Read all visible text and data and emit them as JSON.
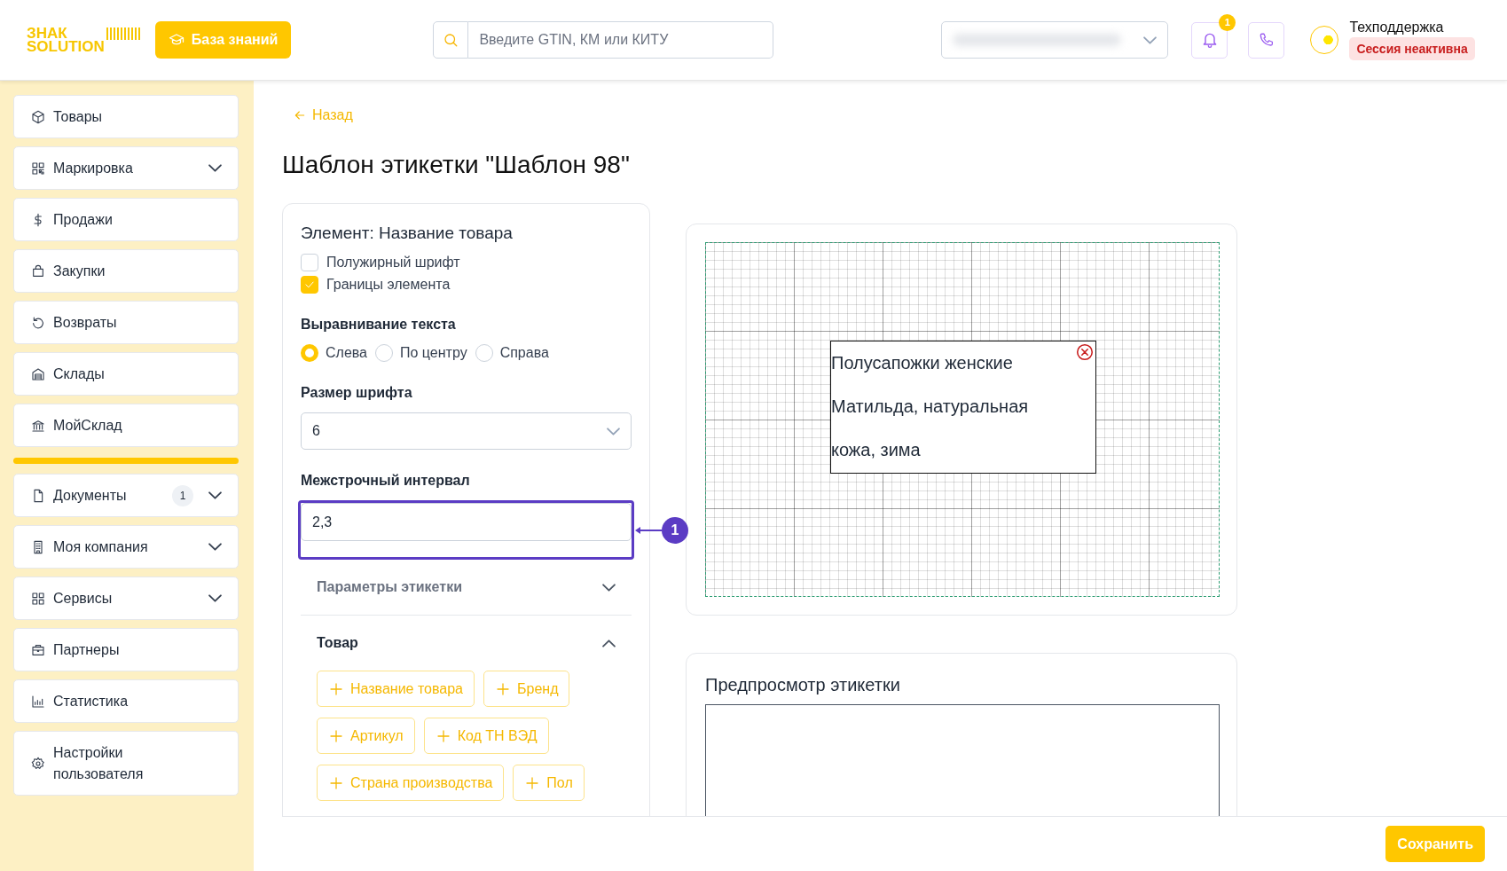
{
  "header": {
    "logo": {
      "line_1": "ЗНАК",
      "line_2": "SOLUTION"
    },
    "knowledge_button": "База знаний",
    "search": {
      "placeholder": "Введите GTIN, КМ или КИТУ"
    },
    "notifications": {
      "badge": "1"
    },
    "user": {
      "name": "Техподдержка",
      "status": "Сессия неактивна"
    }
  },
  "sidebar": {
    "groups": [
      {
        "items": [
          {
            "label": "Товары",
            "kind": "box",
            "expandable": false
          },
          {
            "label": "Маркировка",
            "kind": "qr",
            "expandable": true
          },
          {
            "label": "Продажи",
            "kind": "dollar",
            "expandable": false
          },
          {
            "label": "Закупки",
            "kind": "bag",
            "expandable": false
          },
          {
            "label": "Возвраты",
            "kind": "undo",
            "expandable": false
          },
          {
            "label": "Склады",
            "kind": "warehouse",
            "expandable": false
          },
          {
            "label": "МойСклад",
            "kind": "bank",
            "expandable": false
          }
        ]
      },
      {
        "items": [
          {
            "label": "Документы",
            "kind": "doc",
            "expandable": true,
            "badge": "1"
          },
          {
            "label": "Моя компания",
            "kind": "building",
            "expandable": true
          },
          {
            "label": "Сервисы",
            "kind": "apps",
            "expandable": true
          },
          {
            "label": "Партнеры",
            "kind": "briefcase",
            "expandable": false
          },
          {
            "label": "Статистика",
            "kind": "chart",
            "expandable": false
          },
          {
            "label": "Настройки пользователя",
            "kind": "gear",
            "expandable": false
          }
        ]
      }
    ]
  },
  "back_link": "Назад",
  "title": "Шаблон этикетки \"Шаблон 98\"",
  "element_panel": {
    "heading": "Элемент: Название товара",
    "options": [
      {
        "label": "Полужирный шрифт",
        "checked": false
      },
      {
        "label": "Границы элемента",
        "checked": true
      }
    ],
    "alignment": {
      "label": "Выравнивание текста",
      "choices": [
        {
          "label": "Слева",
          "selected": true
        },
        {
          "label": "По центру",
          "selected": false
        },
        {
          "label": "Справа",
          "selected": false
        }
      ]
    },
    "font_size": {
      "label": "Размер шрифта",
      "value": "6"
    },
    "line_spacing": {
      "label": "Межстрочный интервал",
      "value": "2,3",
      "annotation": "1"
    },
    "sections": [
      {
        "title": "Параметры этикетки",
        "expanded": false
      },
      {
        "title": "Товар",
        "expanded": true,
        "chips": [
          "Название товара",
          "Бренд",
          "Артикул",
          "Код ТН ВЭД",
          "Страна производства",
          "Пол"
        ]
      }
    ]
  },
  "canvas": {
    "element": {
      "lines": [
        "Полусапожки женские",
        "Матильда, натуральная",
        "кожа, зима"
      ]
    }
  },
  "preview": {
    "title": "Предпросмотр этикетки"
  },
  "save_button": "Сохранить"
}
